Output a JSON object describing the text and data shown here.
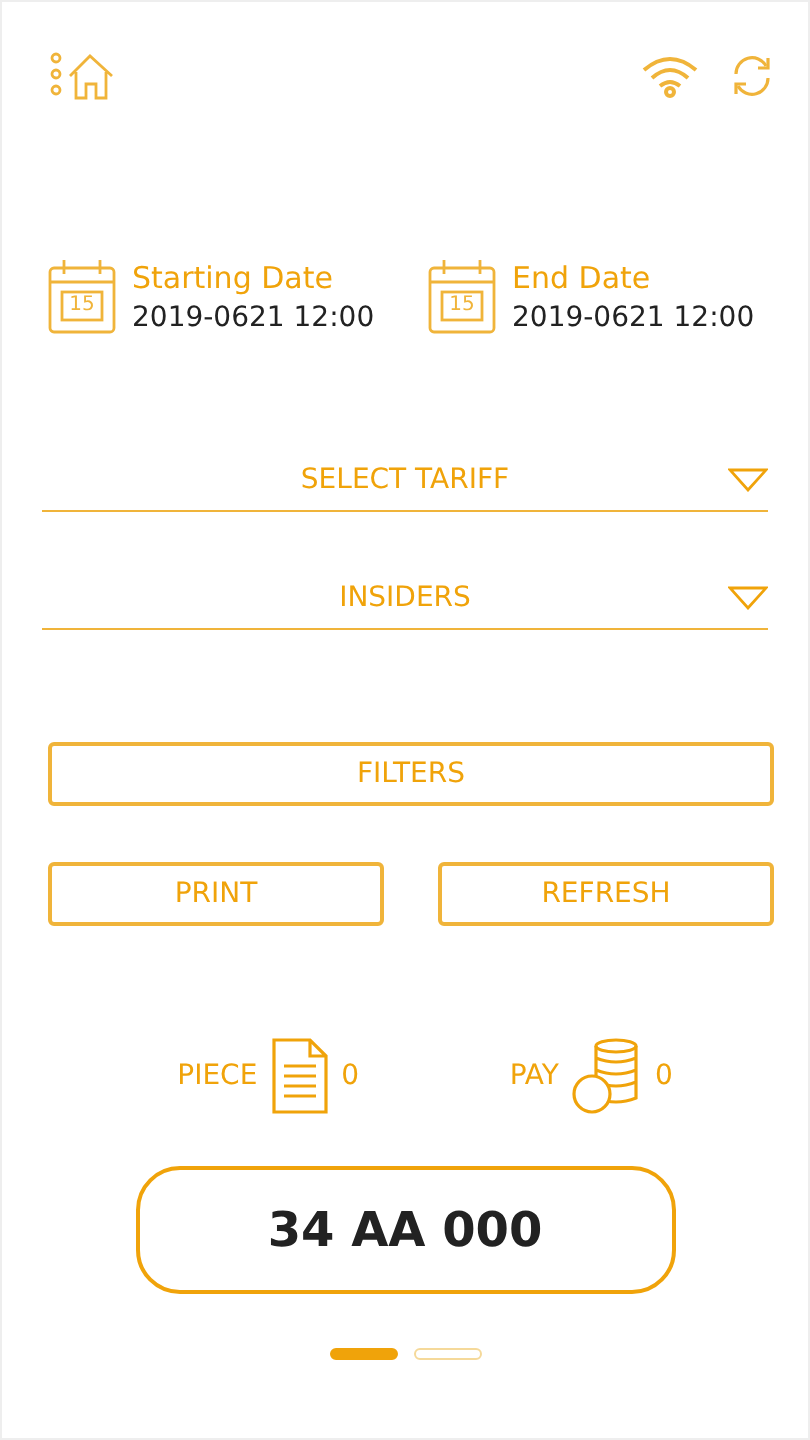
{
  "dates": [
    {
      "label": "Starting Date",
      "value": "2019-0621 12:00",
      "day": "15"
    },
    {
      "label": "End Date",
      "value": "2019-0621 12:00",
      "day": "15"
    }
  ],
  "dropdowns": [
    {
      "label": "SELECT TARIFF"
    },
    {
      "label": "INSIDERS"
    }
  ],
  "filters_button": "FILTERS",
  "buttons": [
    "PRINT",
    "REFRESH"
  ],
  "counters": [
    {
      "kind": "piece",
      "label": "PIECE",
      "value": "0"
    },
    {
      "kind": "pay",
      "label": "PAY",
      "value": "0"
    }
  ],
  "plate": "34 AA 000",
  "pager": [
    {
      "selected": true
    },
    {
      "selected": false
    }
  ]
}
